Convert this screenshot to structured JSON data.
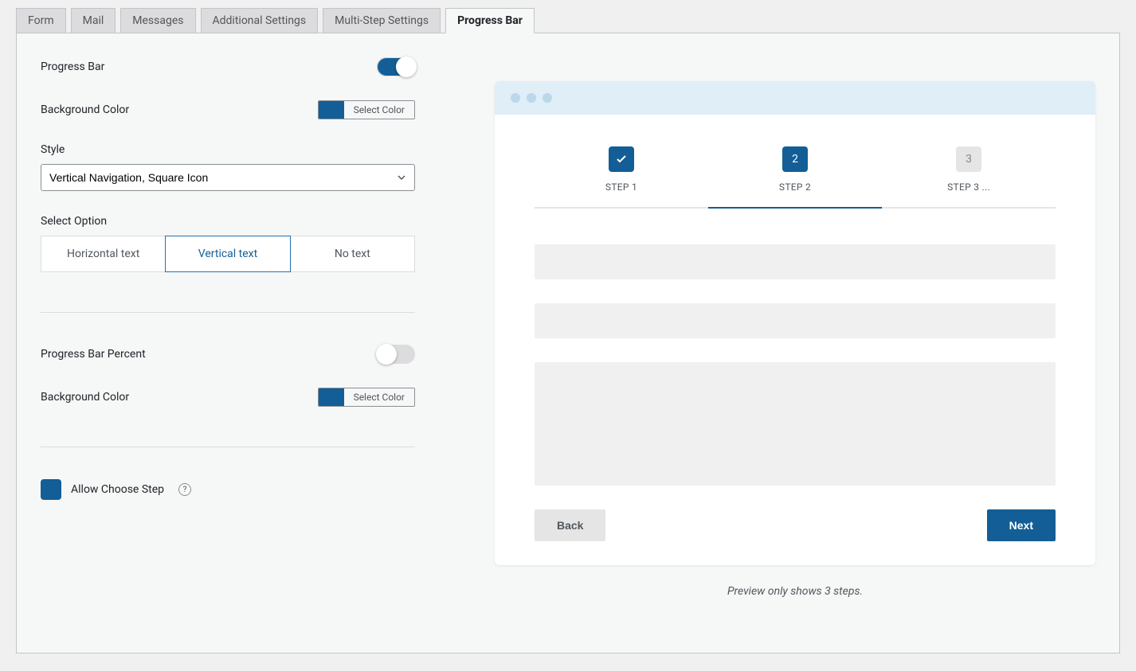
{
  "tabs": {
    "form": "Form",
    "mail": "Mail",
    "messages": "Messages",
    "additional": "Additional Settings",
    "multistep": "Multi-Step Settings",
    "progressbar": "Progress Bar"
  },
  "settings": {
    "progress_bar_label": "Progress Bar",
    "bg_color_label": "Background Color",
    "select_color_btn": "Select Color",
    "style_label": "Style",
    "style_value": "Vertical Navigation, Square Icon",
    "select_option_label": "Select Option",
    "opt_horizontal": "Horizontal text",
    "opt_vertical": "Vertical text",
    "opt_none": "No text",
    "percent_label": "Progress Bar Percent",
    "bg_color_label2": "Background Color",
    "allow_choose_label": "Allow Choose Step",
    "help_icon": "?"
  },
  "preview": {
    "step1_label": "STEP 1",
    "step2_num": "2",
    "step2_label": "STEP 2",
    "step3_num": "3",
    "step3_label": "STEP 3 ...",
    "back": "Back",
    "next": "Next",
    "note": "Preview only shows 3 steps."
  }
}
